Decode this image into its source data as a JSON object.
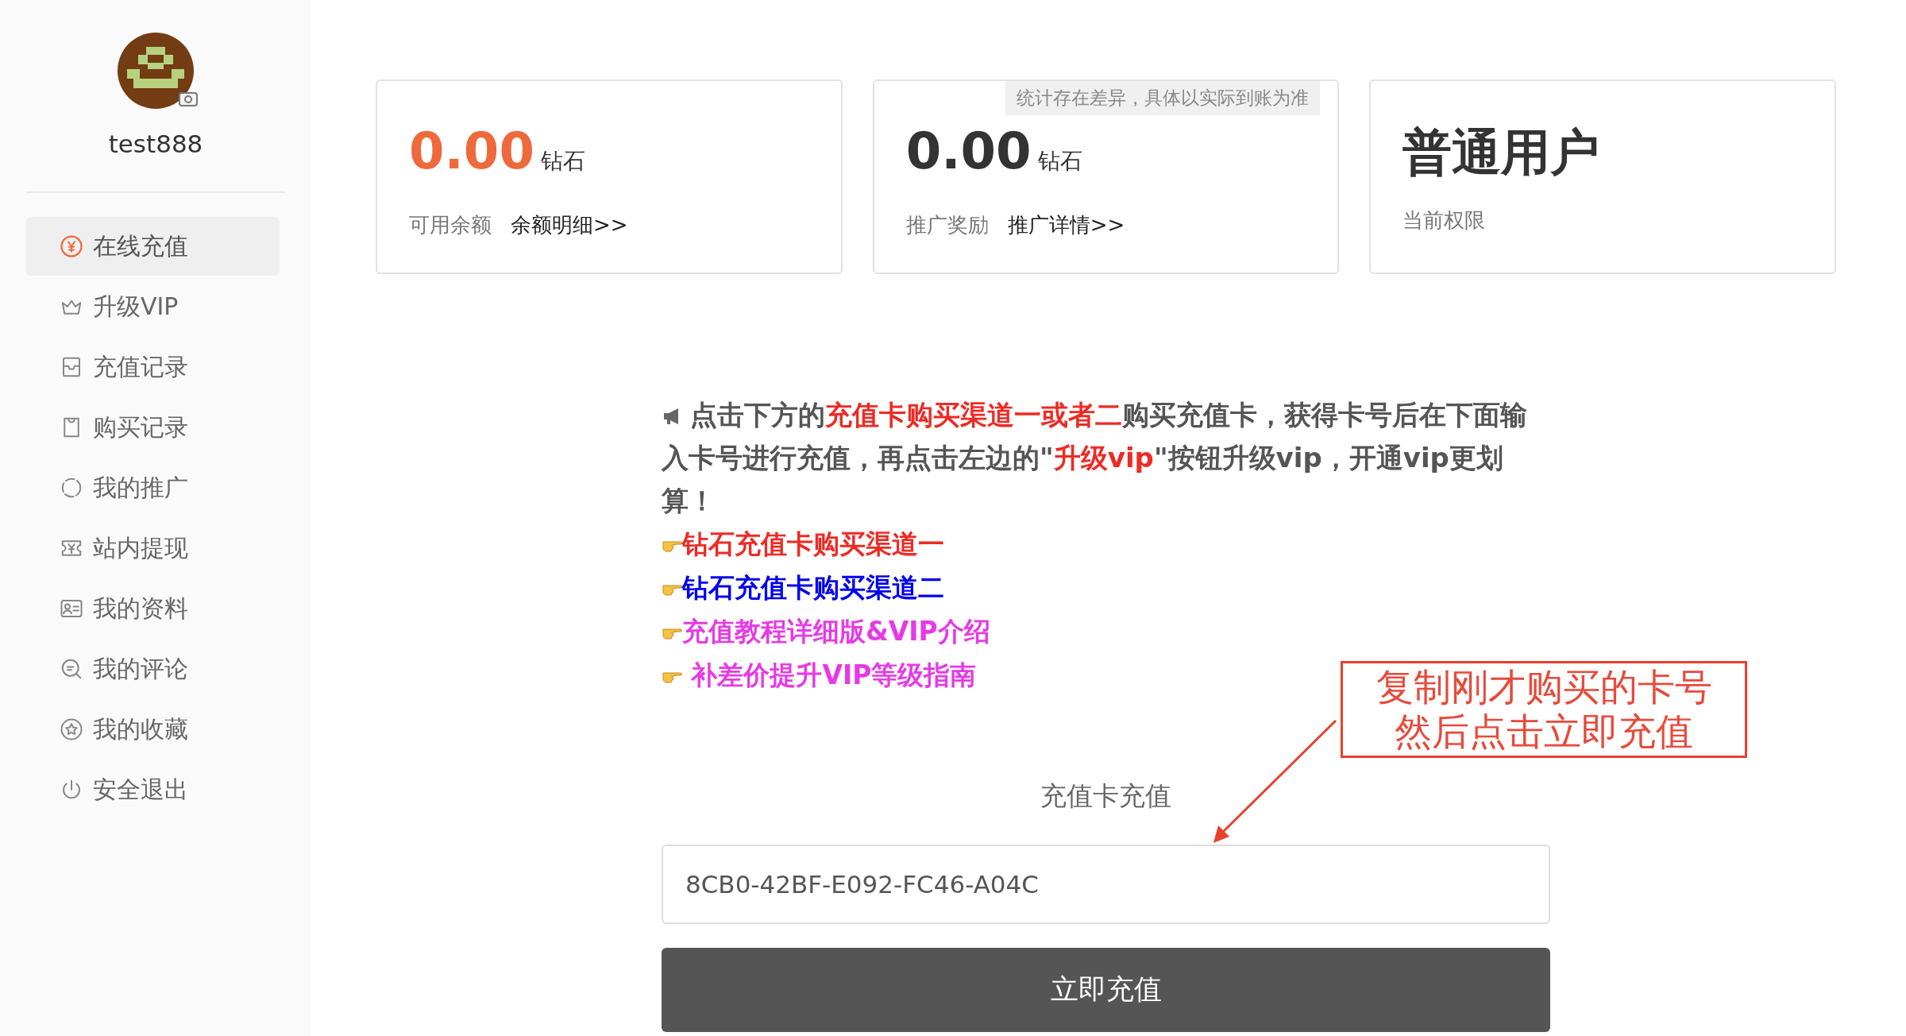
{
  "user": {
    "name": "test888"
  },
  "menu": [
    {
      "label": "在线充值",
      "selected": true
    },
    {
      "label": "升级VIP",
      "selected": false
    },
    {
      "label": "充值记录",
      "selected": false
    },
    {
      "label": "购买记录",
      "selected": false
    },
    {
      "label": "我的推广",
      "selected": false
    },
    {
      "label": "站内提现",
      "selected": false
    },
    {
      "label": "我的资料",
      "selected": false
    },
    {
      "label": "我的评论",
      "selected": false
    },
    {
      "label": "我的收藏",
      "selected": false
    },
    {
      "label": "安全退出",
      "selected": false
    }
  ],
  "cards": [
    {
      "kind": "amount",
      "value": "0.00",
      "unit": "钻石",
      "label": "可用余额",
      "link": "余额明细>>",
      "highlight": true
    },
    {
      "kind": "amount",
      "value": "0.00",
      "unit": "钻石",
      "label": "推广奖励",
      "link": "推广详情>>",
      "note": "统计存在差异，具体以实际到账为准",
      "highlight": false
    },
    {
      "kind": "title",
      "value": "普通用户",
      "label": "当前权限"
    }
  ],
  "notice": {
    "segments": [
      {
        "text": "点击下方的",
        "highlight": false
      },
      {
        "text": "充值卡购买渠道一或者二",
        "highlight": true
      },
      {
        "text": "购买充值卡，获得卡号后在下面输入卡号进行充值，再点击左边的\"",
        "highlight": false
      },
      {
        "text": "升级vip",
        "highlight": true
      },
      {
        "text": "\"按钮升级vip，开通vip更划算！",
        "highlight": false
      }
    ]
  },
  "links": [
    {
      "text": "钻石充值卡购买渠道一",
      "color": "#ee2a24"
    },
    {
      "text": "钻石充值卡购买渠道二",
      "color": "#0000ee"
    },
    {
      "text": "充值教程详细版&VIP介绍",
      "color": "#e63ae6"
    },
    {
      "text": " 补差价提升VIP等级指南",
      "color": "#e63ae6"
    }
  ],
  "recharge": {
    "title": "充值卡充值",
    "value": "8CB0-42BF-E092-FC46-A04C",
    "button": "立即充值"
  },
  "annotation": {
    "lines": [
      "复制刚才购买的卡号",
      "然后点击立即充值"
    ]
  }
}
